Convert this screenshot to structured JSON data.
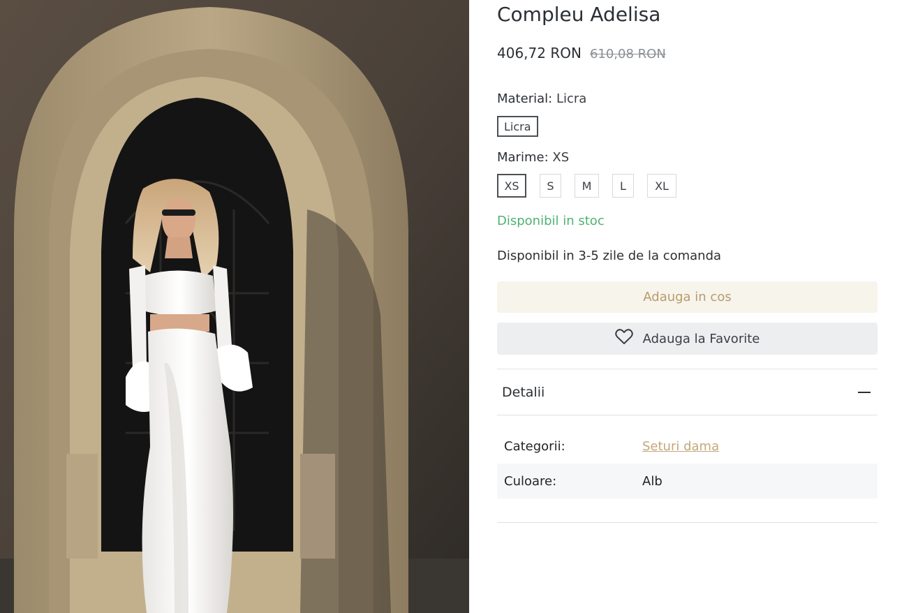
{
  "product": {
    "title": "Compleu Adelisa",
    "price": "406,72 RON",
    "old_price": "610,08 RON"
  },
  "options": {
    "material": {
      "label": "Material:",
      "selected": "Licra",
      "values": [
        "Licra"
      ]
    },
    "size": {
      "label": "Marime:",
      "selected": "XS",
      "values": [
        "XS",
        "S",
        "M",
        "L",
        "XL"
      ]
    }
  },
  "stock": {
    "status": "Disponibil in stoc",
    "status_color": "#4fb272",
    "delivery": "Disponibil in 3-5 zile de la comanda"
  },
  "actions": {
    "add_to_cart": "Adauga in cos",
    "add_to_favorites": "Adauga la Favorite"
  },
  "details": {
    "title": "Detalii",
    "rows": [
      {
        "key": "Categorii:",
        "value": "Seturi dama"
      },
      {
        "key": "Culoare:",
        "value": "Alb"
      }
    ]
  },
  "colors": {
    "accent": "#c4a77a",
    "cart_bg": "#f7f4ec",
    "fav_bg": "#eceef0"
  }
}
